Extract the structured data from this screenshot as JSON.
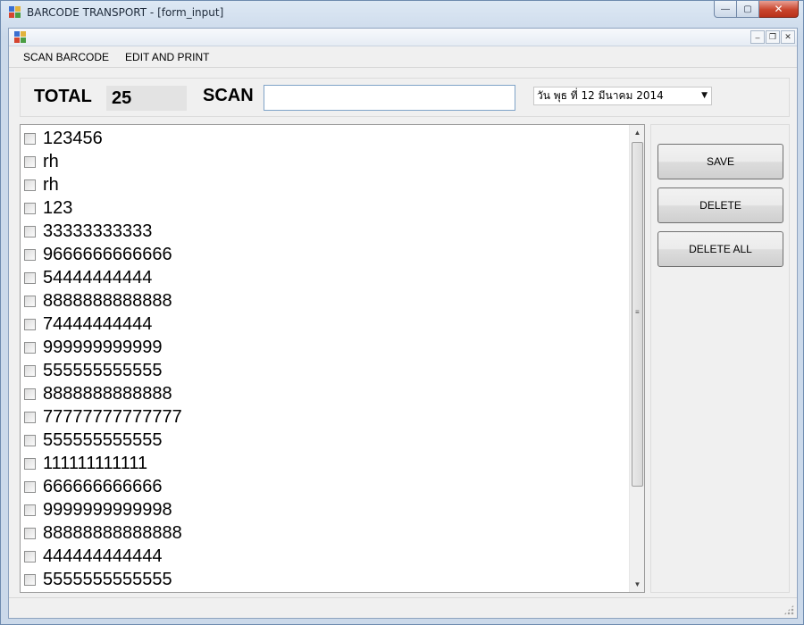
{
  "window": {
    "title": "BARCODE TRANSPORT - [form_input]",
    "controls": {
      "minimize": "—",
      "maximize": "▢",
      "close": "✕"
    }
  },
  "child_window": {
    "controls": {
      "minimize": "–",
      "restore": "❐",
      "close": "✕"
    }
  },
  "menu": {
    "items": [
      {
        "label": "SCAN BARCODE"
      },
      {
        "label": "EDIT AND PRINT"
      }
    ]
  },
  "top_panel": {
    "total_label": "TOTAL",
    "total_value": "25",
    "scan_label": "SCAN",
    "scan_value": "",
    "date_text": "วัน   พุธ    ที่ 12    มีนาคม    2014",
    "date_dropdown_icon": "▼"
  },
  "barcode_list": {
    "items": [
      {
        "label": "123456",
        "checked": false
      },
      {
        "label": "rh",
        "checked": false
      },
      {
        "label": "rh",
        "checked": false
      },
      {
        "label": "123",
        "checked": false
      },
      {
        "label": "33333333333",
        "checked": false
      },
      {
        "label": "9666666666666",
        "checked": false
      },
      {
        "label": "54444444444",
        "checked": false
      },
      {
        "label": "8888888888888",
        "checked": false
      },
      {
        "label": "74444444444",
        "checked": false
      },
      {
        "label": "999999999999",
        "checked": false
      },
      {
        "label": "555555555555",
        "checked": false
      },
      {
        "label": "8888888888888",
        "checked": false
      },
      {
        "label": "77777777777777",
        "checked": false
      },
      {
        "label": "555555555555",
        "checked": false
      },
      {
        "label": "111111111111",
        "checked": false
      },
      {
        "label": "666666666666",
        "checked": false
      },
      {
        "label": "9999999999998",
        "checked": false
      },
      {
        "label": "88888888888888",
        "checked": false
      },
      {
        "label": "444444444444",
        "checked": false
      },
      {
        "label": "5555555555555",
        "checked": false
      }
    ],
    "scroll_up_icon": "▲",
    "scroll_down_icon": "▼"
  },
  "actions": {
    "save": "SAVE",
    "delete": "DELETE",
    "delete_all": "DELETE ALL"
  },
  "colors": {
    "close_button": "#c9452d",
    "window_frame": "#cbd9ea",
    "scan_input_border": "#7fa3c8"
  }
}
